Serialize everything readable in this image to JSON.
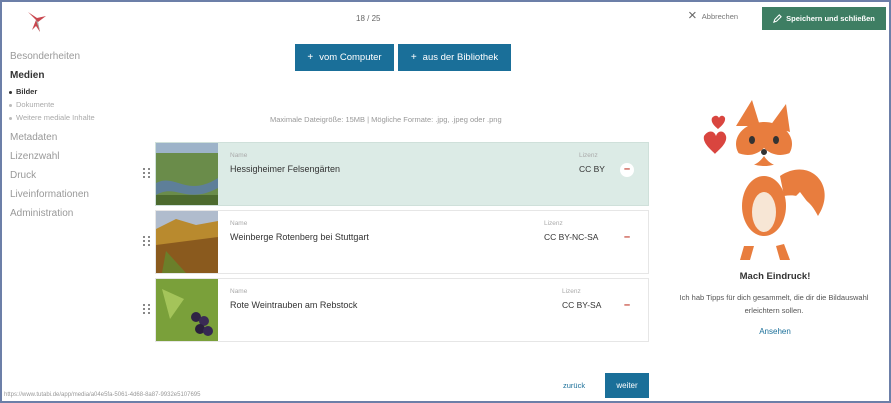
{
  "header": {
    "step": "18 / 25",
    "cancel_label": "Abbrechen",
    "save_label": "Speichern und schließen"
  },
  "sidebar": {
    "items": [
      {
        "label": "Besonderheiten",
        "active": false
      },
      {
        "label": "Medien",
        "active": true
      },
      {
        "label": "Metadaten",
        "active": false
      },
      {
        "label": "Lizenzwahl",
        "active": false
      },
      {
        "label": "Druck",
        "active": false
      },
      {
        "label": "Liveinformationen",
        "active": false
      },
      {
        "label": "Administration",
        "active": false
      }
    ],
    "sub_items": [
      {
        "label": "Bilder",
        "active": true
      },
      {
        "label": "Dokumente",
        "active": false
      },
      {
        "label": "Weitere mediale Inhalte",
        "active": false
      }
    ]
  },
  "upload": {
    "from_computer": "vom Computer",
    "from_library": "aus der Bibliothek",
    "hint": "Maximale Dateigröße: 15MB | Mögliche Formate: .jpg, .jpeg oder .png"
  },
  "images": [
    {
      "name_label": "Name",
      "name": "Hessigheimer Felsengärten",
      "license_label": "Lizenz",
      "license": "CC BY"
    },
    {
      "name_label": "Name",
      "name": "Weinberge Rotenberg bei Stuttgart",
      "license_label": "Lizenz",
      "license": "CC BY-NC-SA"
    },
    {
      "name_label": "Name",
      "name": "Rote Weintrauben am Rebstock",
      "license_label": "Lizenz",
      "license": "CC BY-SA"
    }
  ],
  "footer": {
    "status_url": "https://www.tutabi.de/app/media/a04e5fa-5061-4d68-8a87-9932e5107695",
    "back_label": "zurück",
    "next_label": "weiter"
  },
  "tip": {
    "title": "Mach Eindruck!",
    "text": "Ich hab Tipps für dich gesammelt, die dir die Bildauswahl erleichtern sollen.",
    "link": "Ansehen"
  },
  "colors": {
    "primary": "#1a6f99",
    "save": "#3e7e63",
    "selected_row": "#dcebe6",
    "delete": "#c0392b"
  }
}
